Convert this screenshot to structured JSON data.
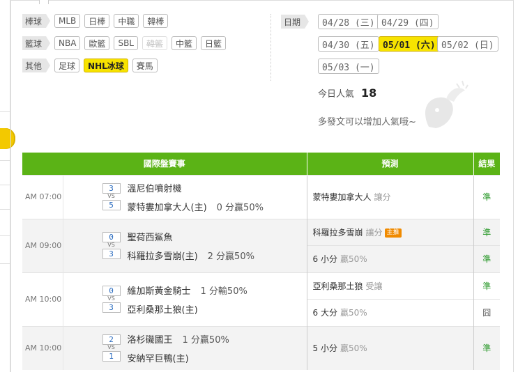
{
  "sports": {
    "rows": [
      {
        "category": "棒球",
        "tags": [
          {
            "label": "MLB",
            "state": "normal"
          },
          {
            "label": "日棒",
            "state": "normal"
          },
          {
            "label": "中職",
            "state": "normal"
          },
          {
            "label": "韓棒",
            "state": "normal"
          }
        ]
      },
      {
        "category": "籃球",
        "tags": [
          {
            "label": "NBA",
            "state": "normal"
          },
          {
            "label": "歐籃",
            "state": "normal"
          },
          {
            "label": "SBL",
            "state": "normal"
          },
          {
            "label": "韓籃",
            "state": "disabled"
          },
          {
            "label": "中籃",
            "state": "normal"
          },
          {
            "label": "日籃",
            "state": "normal"
          }
        ]
      },
      {
        "category": "其他",
        "tags": [
          {
            "label": "足球",
            "state": "normal"
          },
          {
            "label": "NHL冰球",
            "state": "active"
          },
          {
            "label": "賽馬",
            "state": "normal"
          }
        ]
      }
    ]
  },
  "dates": {
    "category": "日期",
    "items": [
      {
        "label": "04/28 (三)",
        "active": false
      },
      {
        "label": "04/29 (四)",
        "active": false
      },
      {
        "label": "04/30 (五)",
        "active": false
      },
      {
        "label": "05/01 (六)",
        "active": true
      },
      {
        "label": "05/02 (日)",
        "active": false
      },
      {
        "label": "05/03 (一)",
        "active": false
      }
    ]
  },
  "popularity": {
    "label": "今日人氣",
    "value": "18",
    "hint": "多發文可以增加人氣哦~"
  },
  "table": {
    "headers": {
      "match": "國際盤賽事",
      "prediction": "預測",
      "result": "結果"
    },
    "vs": "VS",
    "rows": [
      {
        "time": "AM 07:00",
        "shade": false,
        "home": {
          "score": "3",
          "name": "溫尼伯噴射機",
          "note": ""
        },
        "away": {
          "score": "5",
          "name": "蒙特婁加拿大人(主)",
          "note": "0 分贏50%"
        },
        "predictions": [
          {
            "text": "蒙特婁加拿大人",
            "sub": "讓分",
            "badge": "",
            "result": "準",
            "hit": true
          }
        ]
      },
      {
        "time": "AM 09:00",
        "shade": true,
        "home": {
          "score": "0",
          "name": "聖荷西鯊魚",
          "note": ""
        },
        "away": {
          "score": "3",
          "name": "科羅拉多雪崩(主)",
          "note": "2 分贏50%"
        },
        "predictions": [
          {
            "text": "科羅拉多雪崩",
            "sub": "讓分",
            "badge": "主推",
            "result": "準",
            "hit": true
          },
          {
            "text": "6 小分",
            "sub": "贏50%",
            "badge": "",
            "result": "準",
            "hit": true
          }
        ]
      },
      {
        "time": "AM 10:00",
        "shade": false,
        "home": {
          "score": "0",
          "name": "維加斯黃金騎士",
          "note": "1 分輸50%"
        },
        "away": {
          "score": "3",
          "name": "亞利桑那土狼(主)",
          "note": ""
        },
        "predictions": [
          {
            "text": "亞利桑那土狼",
            "sub": "受讓",
            "badge": "",
            "result": "準",
            "hit": true
          },
          {
            "text": "6 大分",
            "sub": "贏50%",
            "badge": "",
            "result": "囧",
            "hit": false
          }
        ]
      },
      {
        "time": "AM 10:00",
        "shade": true,
        "home": {
          "score": "2",
          "name": "洛杉磯國王",
          "note": "1 分贏50%"
        },
        "away": {
          "score": "1",
          "name": "安納罕巨鴨(主)",
          "note": ""
        },
        "predictions": [
          {
            "text": "5 小分",
            "sub": "贏50%",
            "badge": "",
            "result": "準",
            "hit": true
          }
        ]
      }
    ]
  }
}
